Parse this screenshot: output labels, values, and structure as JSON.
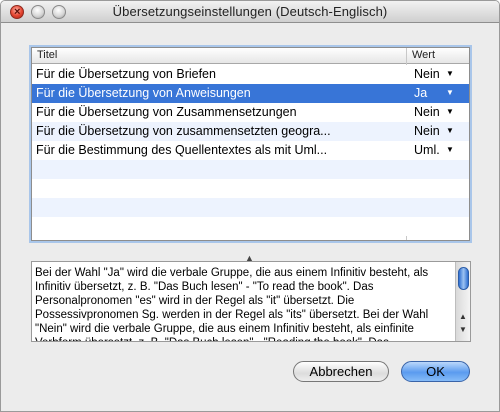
{
  "window": {
    "title": "Übersetzungseinstellungen (Deutsch-Englisch)"
  },
  "table": {
    "headers": {
      "title": "Titel",
      "value": "Wert"
    },
    "rows": [
      {
        "title": "Für die Übersetzung von Briefen",
        "value": "Nein",
        "selected": false
      },
      {
        "title": "Für die Übersetzung von Anweisungen",
        "value": "Ja",
        "selected": true
      },
      {
        "title": "Für die Übersetzung von Zusammensetzungen",
        "value": "Nein",
        "selected": false
      },
      {
        "title": "Für die Übersetzung von zusammensetzten geogra...",
        "value": "Nein",
        "selected": false
      },
      {
        "title": "Für die Bestimmung des Quellentextes als mit Uml...",
        "value": "Uml.",
        "selected": false
      }
    ]
  },
  "description": {
    "text": "Bei der Wahl \"Ja\" wird die verbale Gruppe, die aus einem Infinitiv besteht, als Infinitiv übersetzt, z. B. \"Das Buch lesen\" - \"To read the book\".  Das Personalpronomen \"es\" wird in der Regel als \"it\" übersetzt. Die Possessivpronomen Sg. werden in der Regel als \"its\" übersetzt. Bei der Wahl \"Nein\" wird die verbale Gruppe, die aus einem Infinitiv besteht, als einfinite Verbform übersetzt, z. B. \"Das Buch lesen\" - \"Reading the book\". Das"
  },
  "buttons": {
    "cancel": "Abbrechen",
    "ok": "OK"
  },
  "colors": {
    "selection": "#3875d7",
    "alt_row": "#edf3fe",
    "default_button": "#5a9bef"
  }
}
